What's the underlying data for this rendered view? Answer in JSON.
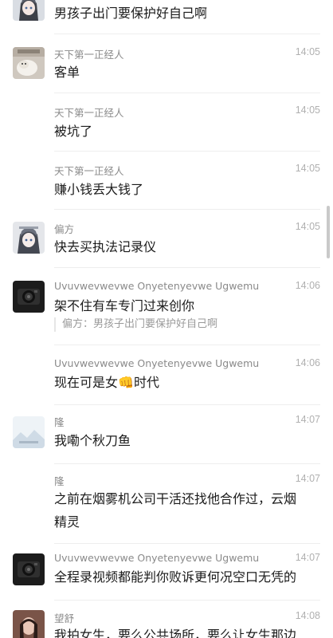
{
  "messages": [
    {
      "sender": "",
      "time": "",
      "text": "男孩子出门要保护好自己啊",
      "avatar": "anime-girl-avatar"
    },
    {
      "sender": "天下第一正经人",
      "time": "14:05",
      "text": "客单",
      "avatar": "cat-avatar"
    },
    {
      "sender": "天下第一正经人",
      "time": "14:05",
      "text": "被坑了",
      "avatar": ""
    },
    {
      "sender": "天下第一正经人",
      "time": "14:05",
      "text": "赚小钱丢大钱了",
      "avatar": ""
    },
    {
      "sender": "偏方",
      "time": "14:05",
      "text": "快去买执法记录仪",
      "avatar": "anime-girl-avatar"
    },
    {
      "sender": "Uvuvwevwevwe Onyetenyevwe Ugwemu",
      "time": "14:06",
      "text": "架不住有车专门过来创你",
      "quote": "偏方：男孩子出门要保护好自己啊",
      "avatar": "camera-avatar"
    },
    {
      "sender": "Uvuvwevwevwe Onyetenyevwe Ugwemu",
      "time": "14:06",
      "text_before": "现在可是女",
      "emoji": "👊",
      "text_after": "时代",
      "avatar": ""
    },
    {
      "sender": "隆",
      "time": "14:07",
      "text": "我嘞个秋刀鱼",
      "avatar": "landscape-avatar"
    },
    {
      "sender": "隆",
      "time": "14:07",
      "text_line1": "之前在烟雾机公司干活还找他合作过，云烟",
      "text_line2": "精灵",
      "avatar": ""
    },
    {
      "sender": "Uvuvwevwevwe Onyetenyevwe Ugwemu",
      "time": "14:07",
      "text": "全程录视频都能判你败诉更何况空口无凭的",
      "avatar": "camera-avatar"
    },
    {
      "sender": "望舒",
      "time": "14:08",
      "text": "我拍女生，要么公共场所，要么让女生那边",
      "avatar": "photo-avatar"
    }
  ],
  "colors": {
    "name": "#8a8a8a",
    "time": "#b0b0b0",
    "text": "#1b1b1b",
    "divider": "#eeeeee",
    "quote": "#9a9a9a"
  }
}
